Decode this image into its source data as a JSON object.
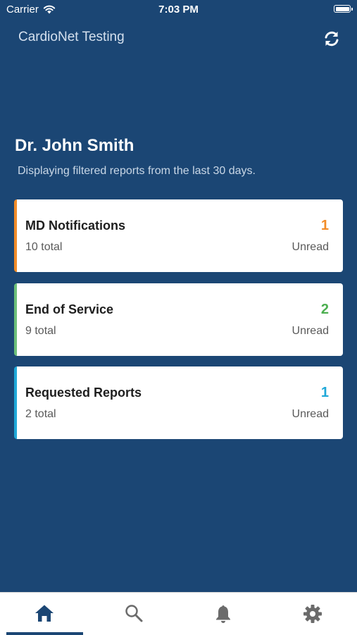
{
  "status_bar": {
    "carrier": "Carrier",
    "time": "7:03 PM"
  },
  "header": {
    "app_title": "CardioNet Testing",
    "refresh_icon": "refresh-icon"
  },
  "user": {
    "name": "Dr. John Smith",
    "filter_note": "Displaying filtered reports from the last 30 days."
  },
  "cards": [
    {
      "title": "MD Notifications",
      "count": "1",
      "total": "10 total",
      "status": "Unread",
      "accent": "#f28c28",
      "count_color": "#f28c28"
    },
    {
      "title": "End of Service",
      "count": "2",
      "total": "9 total",
      "status": "Unread",
      "accent": "#6cbf7a",
      "count_color": "#4caf50"
    },
    {
      "title": "Requested Reports",
      "count": "1",
      "total": "2 total",
      "status": "Unread",
      "accent": "#1fa8d8",
      "count_color": "#1fa8d8"
    }
  ],
  "tabbar": {
    "tabs": [
      {
        "icon": "home-icon",
        "active": true,
        "color": "#1b4674"
      },
      {
        "icon": "search-icon",
        "active": false,
        "color": "#6b6b6b"
      },
      {
        "icon": "bell-icon",
        "active": false,
        "color": "#6b6b6b"
      },
      {
        "icon": "gear-icon",
        "active": false,
        "color": "#6b6b6b"
      }
    ]
  }
}
